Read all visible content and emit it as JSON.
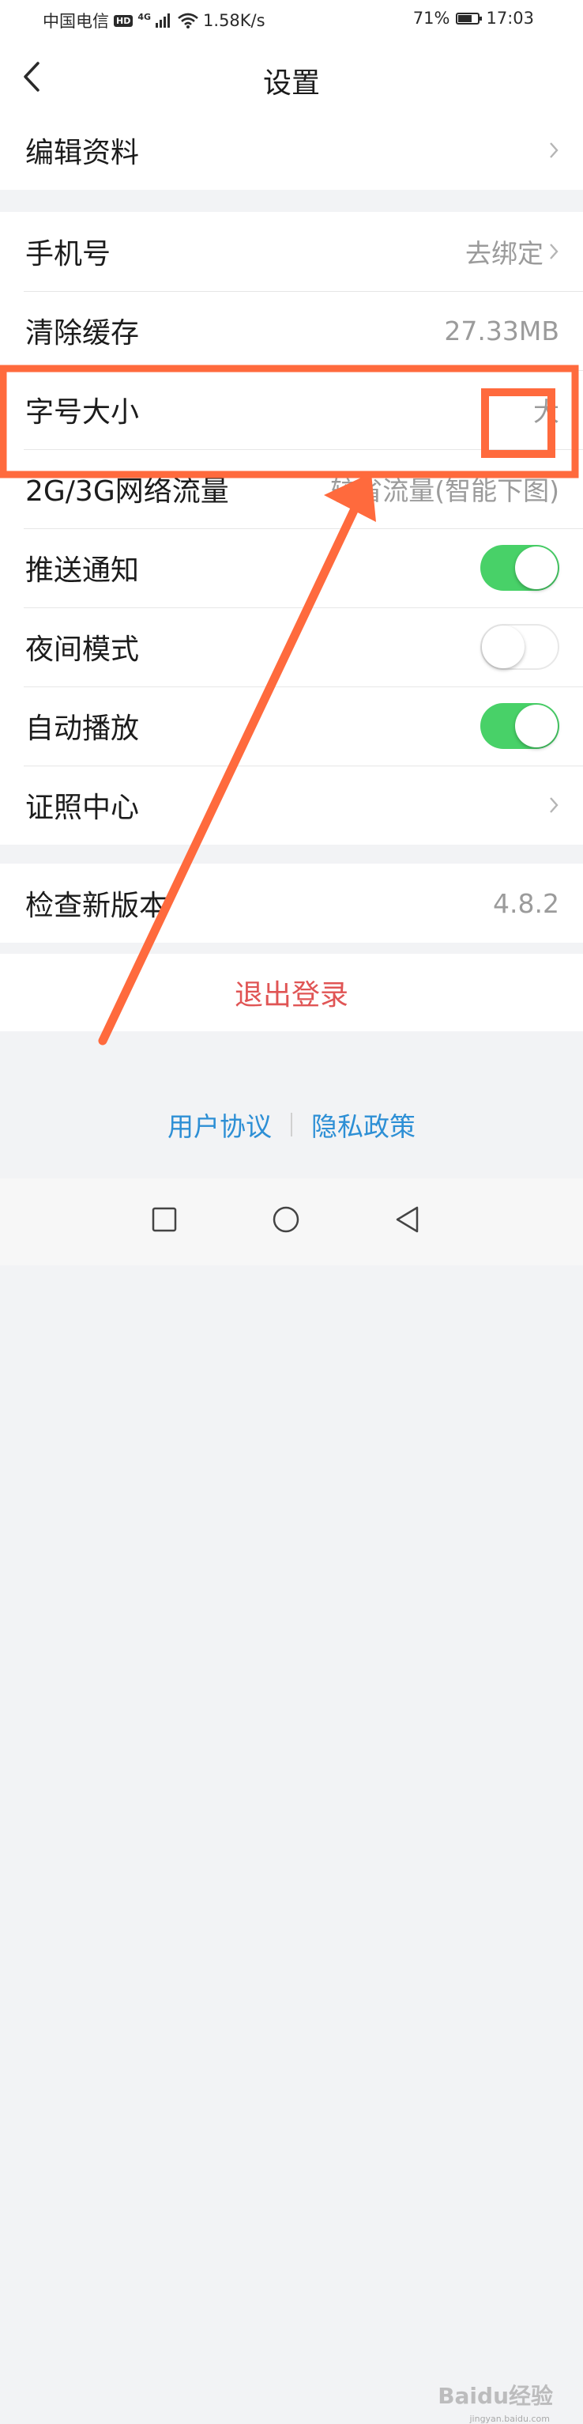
{
  "status_bar": {
    "carrier": "中国电信",
    "hd": "HD",
    "network": "4G",
    "speed": "1.58K/s",
    "battery": "71%",
    "battery_level": 0.71,
    "time": "17:03"
  },
  "header": {
    "title": "设置",
    "back_icon": "chevron-left-icon"
  },
  "groups": [
    {
      "rows": [
        {
          "label": "编辑资料",
          "value": "",
          "chevron": true
        }
      ]
    },
    {
      "rows": [
        {
          "label": "手机号",
          "value": "去绑定",
          "chevron": true
        },
        {
          "label": "清除缓存",
          "value": "27.33MB"
        },
        {
          "label": "字号大小",
          "value": "大"
        },
        {
          "label": "2G/3G网络流量",
          "value": "较省流量(智能下图)"
        },
        {
          "label": "推送通知",
          "toggle": true
        },
        {
          "label": "夜间模式",
          "toggle": false
        },
        {
          "label": "自动播放",
          "toggle": true
        },
        {
          "label": "证照中心",
          "value": "",
          "chevron": true
        }
      ]
    },
    {
      "rows": [
        {
          "label": "检查新版本",
          "value": "4.8.2"
        }
      ]
    }
  ],
  "logout": {
    "label": "退出登录"
  },
  "footer": {
    "user_agreement": "用户协议",
    "privacy_policy": "隐私政策"
  },
  "system_nav": [
    "square-icon",
    "circle-icon",
    "triangle-back-icon"
  ],
  "watermark": {
    "brand": "Baidu经验",
    "url": "jingyan.baidu.com"
  },
  "colors": {
    "accent_red": "#e05555",
    "link_blue": "#2d8fd5",
    "toggle_green": "#48d168",
    "annotation_orange": "#ff6a3d"
  }
}
